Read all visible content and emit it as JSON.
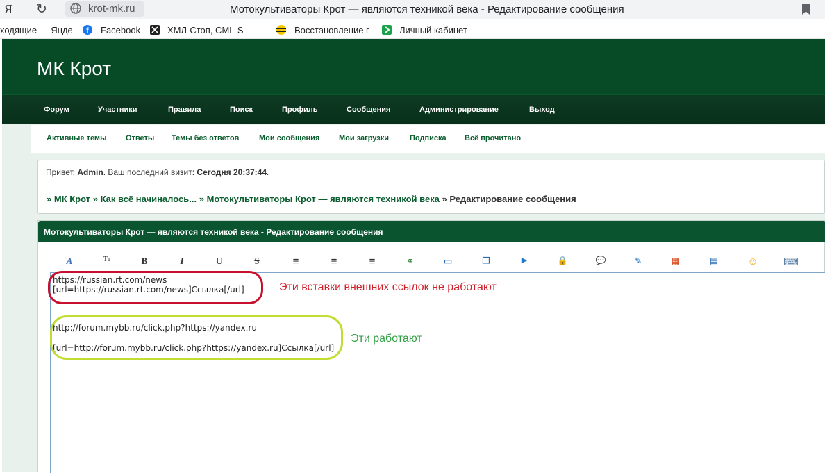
{
  "browser": {
    "yandex_logo": "Я",
    "url": "krot-mk.ru",
    "page_title": "Мотокультиваторы Крот — являются техникой века - Редактирование сообщения"
  },
  "bookmarks": [
    {
      "label": "ходящие — Янде",
      "icon": "none"
    },
    {
      "label": "Facebook",
      "icon": "facebook-icon",
      "color": "#1877f2"
    },
    {
      "label": "ХМЛ-Стоп, CML-S",
      "icon": "xml-stop-icon",
      "color": "#222222"
    },
    {
      "label": "Восстановление п",
      "icon": "beeline-icon",
      "color": "#f6c700"
    },
    {
      "label": "Личный кабинет",
      "icon": "green-arrow-icon",
      "color": "#1aa34a"
    }
  ],
  "site": {
    "title": "МК Крот",
    "colors": {
      "header": "#064a26",
      "nav": "#0e3a22",
      "link": "#0b5d2e"
    }
  },
  "nav": [
    "Форум",
    "Участники",
    "Правила",
    "Поиск",
    "Профиль",
    "Сообщения",
    "Администрирование",
    "Выход"
  ],
  "subnav": [
    "Активные темы",
    "Ответы",
    "Темы без ответов",
    "Мои сообщения",
    "Мои загрузки",
    "Подписка",
    "Всё прочитано"
  ],
  "greeting": {
    "prefix": "Привет, ",
    "user": "Admin",
    "middle": ".  Ваш последний визит: ",
    "last_visit": "Сегодня 20:37:44",
    "suffix": "."
  },
  "breadcrumb": {
    "separator": "»",
    "items": [
      "МК Крот",
      "Как всё начиналось...",
      "Мотокультиваторы Крот — являются техникой века"
    ],
    "current": "Редактирование сообщения"
  },
  "panel": {
    "title": "Мотокультиваторы Крот — являются техникой века - Редактирование сообщения"
  },
  "toolbar": [
    {
      "name": "font-color-icon",
      "glyph": "A"
    },
    {
      "name": "font-size-icon",
      "glyph": "Tт"
    },
    {
      "name": "bold-icon",
      "glyph": "B"
    },
    {
      "name": "italic-icon",
      "glyph": "I"
    },
    {
      "name": "underline-icon",
      "glyph": "U"
    },
    {
      "name": "strikethrough-icon",
      "glyph": "S"
    },
    {
      "name": "align-left-icon",
      "glyph": "≡"
    },
    {
      "name": "align-center-icon",
      "glyph": "≡"
    },
    {
      "name": "align-right-icon",
      "glyph": "≡"
    },
    {
      "name": "link-icon",
      "glyph": "⚭"
    },
    {
      "name": "book-icon",
      "glyph": "▭"
    },
    {
      "name": "copy-icon",
      "glyph": "❐"
    },
    {
      "name": "video-icon",
      "glyph": "▶"
    },
    {
      "name": "lock-icon",
      "glyph": "🔒"
    },
    {
      "name": "speech-bubble-icon",
      "glyph": "💬"
    },
    {
      "name": "edit-image-icon",
      "glyph": "✎"
    },
    {
      "name": "color-grid-icon",
      "glyph": "▦"
    },
    {
      "name": "table-icon",
      "glyph": "▤"
    },
    {
      "name": "smiley-icon",
      "glyph": "☺"
    },
    {
      "name": "keyboard-icon",
      "glyph": "⌨"
    }
  ],
  "editor": {
    "lines": [
      "https://russian.rt.com/news",
      "[url=https://russian.rt.com/news]Ссылка[/url]",
      "http://forum.mybb.ru/click.php?https://yandex.ru",
      "[url=http://forum.mybb.ru/click.php?https://yandex.ru]Ссылка[/url]"
    ]
  },
  "annotations": {
    "not_working": "Эти вставки внешних ссылок не работают",
    "working": "Эти работают",
    "not_working_color": "#d0202a",
    "working_color": "#33a047"
  }
}
